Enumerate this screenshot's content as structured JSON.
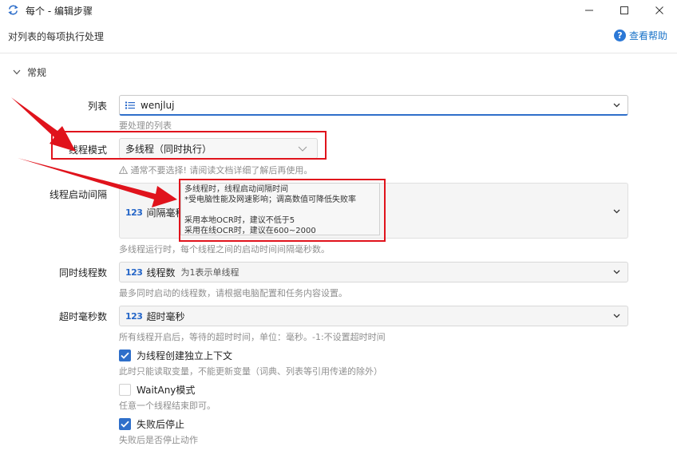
{
  "window": {
    "title": "每个 - 编辑步骤",
    "icons": {
      "app": "loop-arrows-icon",
      "minimize": "minimize-icon",
      "maximize": "maximize-icon",
      "close": "close-icon"
    }
  },
  "header": {
    "subtitle": "对列表的每项执行处理",
    "help_label": "查看帮助",
    "help_icon": "question-circle-icon"
  },
  "section": {
    "title": "常规"
  },
  "fields": {
    "list": {
      "label": "列表",
      "value": "wenjluj",
      "hint": "要处理的列表"
    },
    "thread_mode": {
      "label": "线程模式",
      "value": "多线程（同时执行）",
      "hint": "通常不要选择! 请阅读文档详细了解后再使用。"
    },
    "start_interval": {
      "label": "线程启动间隔",
      "placeholder": "间隔毫秒",
      "hint": "多线程运行时，每个线程之间的启动时间间隔毫秒数。"
    },
    "concurrent": {
      "label": "同时线程数",
      "placeholder": "线程数",
      "placeholder_sub": "为1表示单线程",
      "hint": "最多同时启动的线程数，请根据电脑配置和任务内容设置。"
    },
    "timeout": {
      "label": "超时毫秒数",
      "placeholder": "超时毫秒",
      "hint": "所有线程开启后，等待的超时时间，单位：毫秒。-1:不设置超时时间"
    }
  },
  "tooltip": {
    "lines": [
      "多线程时，线程启动间隔时间",
      "*受电脑性能及网速影响；调高数值可降低失败率",
      "",
      "采用本地OCR时，建议不低于5",
      "采用在线OCR时，建议在600~2000"
    ]
  },
  "checkboxes": [
    {
      "label": "为线程创建独立上下文",
      "checked": true,
      "hint": "此时只能读取变量，不能更新变量（词典、列表等引用传递的除外）"
    },
    {
      "label": "WaitAny模式",
      "checked": false,
      "hint": "任意一个线程结束即可。"
    },
    {
      "label": "失败后停止",
      "checked": true,
      "hint": "失败后是否停止动作"
    }
  ],
  "colors": {
    "accent": "#2f6fca",
    "annotation": "#e0131c",
    "help_link": "#1a73c8"
  }
}
